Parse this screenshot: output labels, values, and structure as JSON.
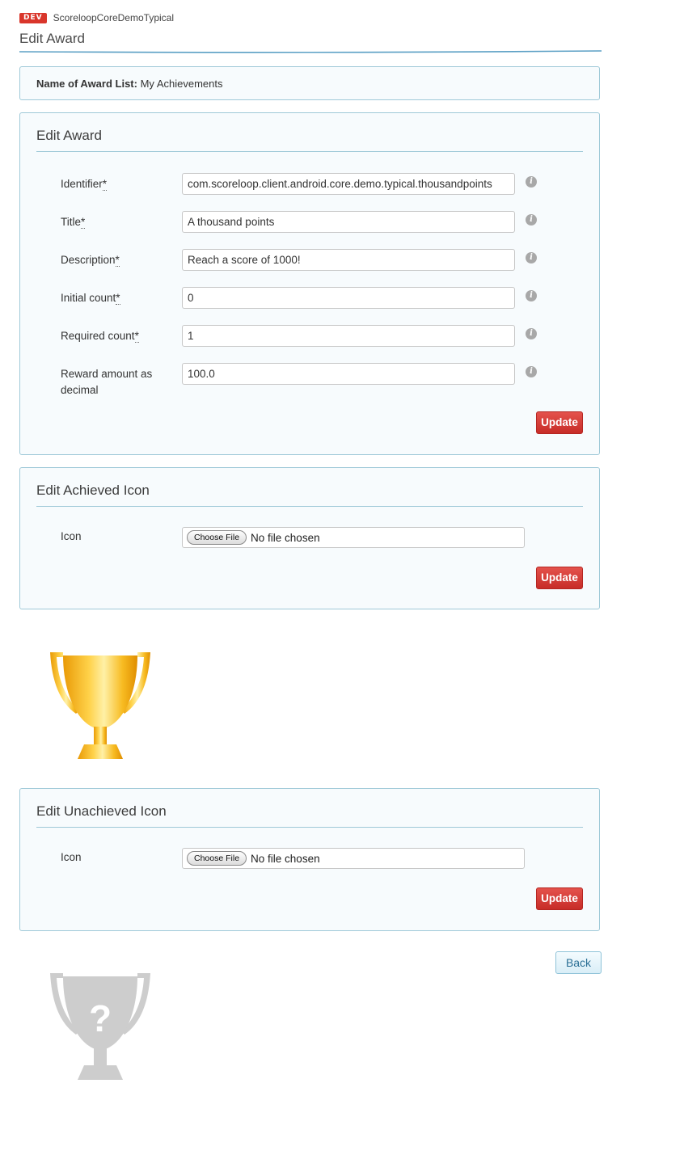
{
  "header": {
    "dev_badge": "DEV",
    "app_name": "ScoreloopCoreDemoTypical",
    "page_title": "Edit Award"
  },
  "award_list": {
    "label": "Name of Award List:",
    "value": "My Achievements"
  },
  "edit_award": {
    "title": "Edit Award",
    "fields": [
      {
        "label": "Identifier",
        "required": "*",
        "value": "com.scoreloop.client.android.core.demo.typical.thousandpoints"
      },
      {
        "label": "Title",
        "required": "*",
        "value": "A thousand points"
      },
      {
        "label": "Description",
        "required": "*",
        "value": "Reach a score of 1000!"
      },
      {
        "label": "Initial count",
        "required": "*",
        "value": "0"
      },
      {
        "label": "Required count",
        "required": "*",
        "value": "1"
      },
      {
        "label": "Reward amount as decimal",
        "required": "",
        "value": "100.0"
      }
    ],
    "info_icon": "info-icon",
    "update_label": "Update"
  },
  "achieved_icon": {
    "title": "Edit Achieved Icon",
    "icon_label": "Icon",
    "choose_file_label": "Choose File",
    "no_file_text": "No file chosen",
    "update_label": "Update",
    "image": "gold-trophy-icon"
  },
  "unachieved_icon": {
    "title": "Edit Unachieved Icon",
    "icon_label": "Icon",
    "choose_file_label": "Choose File",
    "no_file_text": "No file chosen",
    "update_label": "Update",
    "image": "gray-question-trophy-icon",
    "image_mark": "?"
  },
  "back_label": "Back",
  "colors": {
    "accent_red": "#d33b35",
    "panel_border": "#9fc9d8",
    "panel_bg": "#f7fbfd",
    "trophy_gold": "#f3b21b",
    "trophy_gray": "#cccccc"
  }
}
